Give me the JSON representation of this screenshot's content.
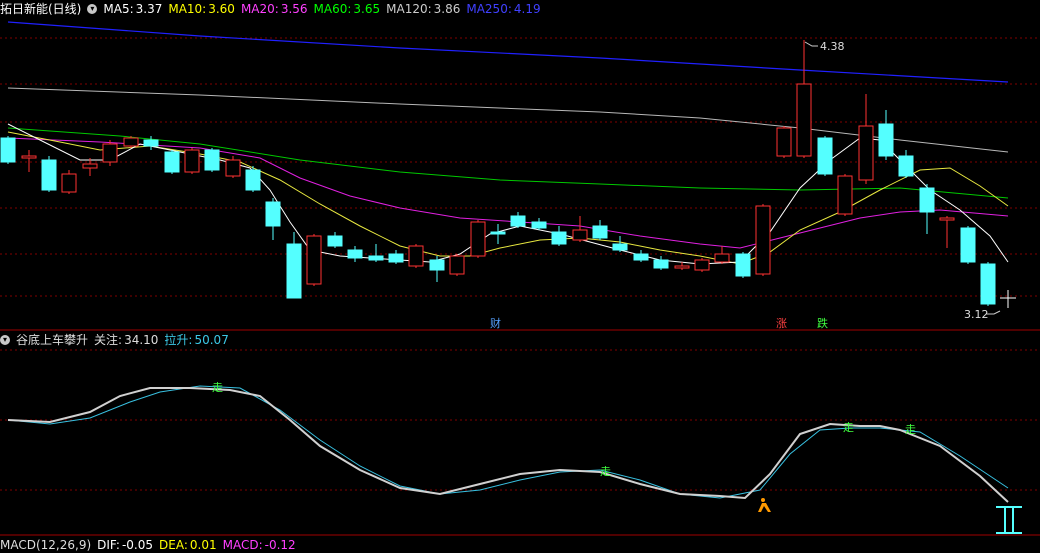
{
  "header": {
    "title": "拓日新能(日线)",
    "ma5": {
      "label": "MA5:",
      "value": "3.37",
      "color": "#ffffff"
    },
    "ma10": {
      "label": "MA10:",
      "value": "3.60",
      "color": "#ffff00"
    },
    "ma20": {
      "label": "MA20:",
      "value": "3.56",
      "color": "#ff00ff"
    },
    "ma60": {
      "label": "MA60:",
      "value": "3.65",
      "color": "#00ff00"
    },
    "ma120": {
      "label": "MA120:",
      "value": "3.86",
      "color": "#cccccc"
    },
    "ma250": {
      "label": "MA250:",
      "value": "4.19",
      "color": "#3030ff"
    }
  },
  "price_labels": {
    "high": "4.38",
    "low": "3.12"
  },
  "event_markers": {
    "cai": "财",
    "zhang": "涨",
    "die": "跌"
  },
  "indicator": {
    "name": "谷底上车攀升",
    "focus_label": "关注:",
    "focus_value": "34.10",
    "lift_label": "拉升:",
    "lift_value": "50.07",
    "marker_zou": "走"
  },
  "macd": {
    "name": "MACD(12,26,9)",
    "dif_label": "DIF:",
    "dif_value": "-0.05",
    "dea_label": "DEA:",
    "dea_value": "0.01",
    "macd_label": "MACD:",
    "macd_value": "-0.12"
  },
  "colors": {
    "up": "#ff3232",
    "down": "#54ffff",
    "grid": "#800000",
    "indicator_main": "#d0d0d0",
    "indicator_signal": "#3cc8e6"
  }
}
